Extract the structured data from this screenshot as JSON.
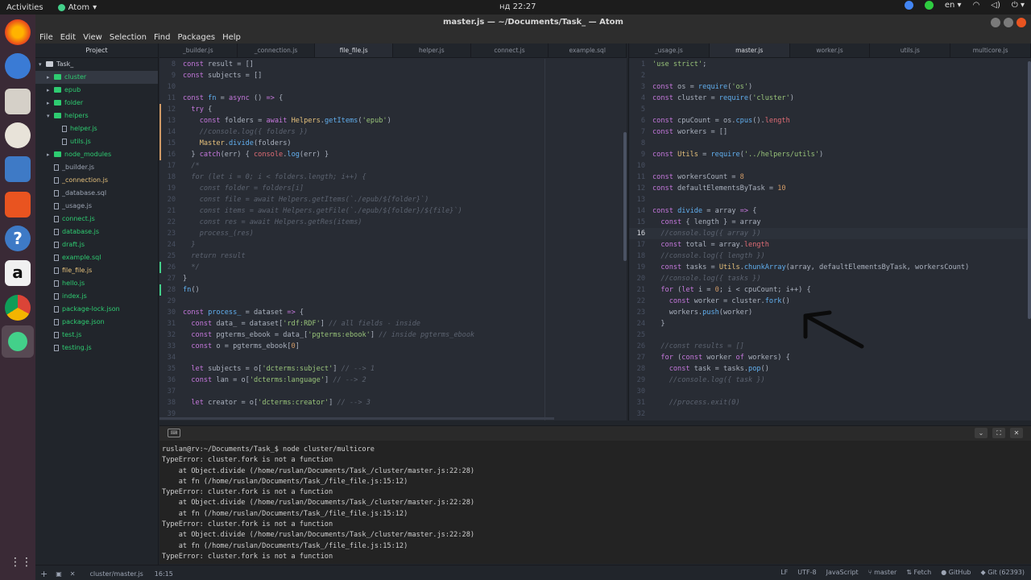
{
  "topbar": {
    "activities": "Activities",
    "app_name": "Atom",
    "clock": "нд 22:27",
    "lang": "en"
  },
  "window": {
    "title": "master.js — ~/Documents/Task_ — Atom"
  },
  "menu": [
    "File",
    "Edit",
    "View",
    "Selection",
    "Find",
    "Packages",
    "Help"
  ],
  "tree": {
    "title": "Project",
    "items": [
      {
        "label": "Task_",
        "type": "root",
        "indent": 0
      },
      {
        "label": "cluster",
        "type": "folder",
        "indent": 1,
        "selected": true
      },
      {
        "label": "epub",
        "type": "folder",
        "indent": 1
      },
      {
        "label": "folder",
        "type": "folder",
        "indent": 1
      },
      {
        "label": "helpers",
        "type": "folder-open",
        "indent": 1
      },
      {
        "label": "helper.js",
        "type": "file",
        "indent": 2
      },
      {
        "label": "utils.js",
        "type": "file",
        "indent": 2
      },
      {
        "label": "node_modules",
        "type": "folder",
        "indent": 1
      },
      {
        "label": "_builder.js",
        "type": "file",
        "indent": 1,
        "muted": true
      },
      {
        "label": "_connection.js",
        "type": "file",
        "indent": 1,
        "yellow": true
      },
      {
        "label": "_database.sql",
        "type": "file",
        "indent": 1,
        "muted": true
      },
      {
        "label": "_usage.js",
        "type": "file",
        "indent": 1,
        "muted": true
      },
      {
        "label": "connect.js",
        "type": "file",
        "indent": 1
      },
      {
        "label": "database.js",
        "type": "file",
        "indent": 1
      },
      {
        "label": "draft.js",
        "type": "file",
        "indent": 1
      },
      {
        "label": "example.sql",
        "type": "file",
        "indent": 1
      },
      {
        "label": "file_file.js",
        "type": "file",
        "indent": 1,
        "yellow": true
      },
      {
        "label": "hello.js",
        "type": "file",
        "indent": 1
      },
      {
        "label": "index.js",
        "type": "file",
        "indent": 1
      },
      {
        "label": "package-lock.json",
        "type": "file",
        "indent": 1
      },
      {
        "label": "package.json",
        "type": "file",
        "indent": 1
      },
      {
        "label": "test.js",
        "type": "file",
        "indent": 1
      },
      {
        "label": "testing.js",
        "type": "file",
        "indent": 1
      }
    ]
  },
  "left_tabs": [
    "_builder.js",
    "_connection.js",
    "file_file.js",
    "helper.js",
    "connect.js",
    "example.sql"
  ],
  "left_active_tab": 2,
  "right_tabs": [
    "_usage.js",
    "master.js",
    "worker.js",
    "utils.js",
    "multicore.js"
  ],
  "right_active_tab": 1,
  "left_code": [
    {
      "n": "8",
      "h": "<span class='k'>const</span> result = []"
    },
    {
      "n": "9",
      "h": "<span class='k'>const</span> subjects = []"
    },
    {
      "n": "10",
      "h": ""
    },
    {
      "n": "11",
      "h": "<span class='k'>const</span> <span class='f'>fn</span> = <span class='k'>async</span> () <span class='k'>=&gt;</span> {"
    },
    {
      "n": "12",
      "h": "  <span class='k'>try</span> {",
      "mod": true
    },
    {
      "n": "13",
      "h": "    <span class='k'>const</span> folders = <span class='k'>await</span> <span class='cls'>Helpers</span>.<span class='f'>getItems</span>(<span class='s'>'epub'</span>)",
      "mod": true
    },
    {
      "n": "14",
      "h": "    <span class='c'>//console.log({ folders })</span>",
      "mod": true
    },
    {
      "n": "15",
      "h": "    <span class='cls'>Master</span>.<span class='f'>divide</span>(folders)",
      "mod": true
    },
    {
      "n": "16",
      "h": "  } <span class='k'>catch</span>(err) { <span class='r'>console</span>.<span class='f'>log</span>(err) }",
      "mod": true
    },
    {
      "n": "17",
      "h": "  <span class='c'>/*</span>"
    },
    {
      "n": "18",
      "h": "  <span class='c'>for (let i = 0; i &lt; folders.length; i++) {</span>"
    },
    {
      "n": "19",
      "h": "    <span class='c'>const folder = folders[i]</span>"
    },
    {
      "n": "20",
      "h": "    <span class='c'>const file = await Helpers.getItems(`./epub/${folder}`)</span>"
    },
    {
      "n": "21",
      "h": "    <span class='c'>const items = await Helpers.getFile(`./epub/${folder}/${file}`)</span>"
    },
    {
      "n": "22",
      "h": "    <span class='c'>const res = await Helpers.getRes(items)</span>"
    },
    {
      "n": "23",
      "h": "    <span class='c'>process_(res)</span>"
    },
    {
      "n": "24",
      "h": "  <span class='c'>}</span>"
    },
    {
      "n": "25",
      "h": "  <span class='c'>return result</span>"
    },
    {
      "n": "26",
      "h": "  <span class='c'>*/</span>",
      "add": true
    },
    {
      "n": "27",
      "h": "}"
    },
    {
      "n": "28",
      "h": "<span class='f'>fn</span>()",
      "add": true
    },
    {
      "n": "29",
      "h": ""
    },
    {
      "n": "30",
      "h": "<span class='k'>const</span> <span class='f'>process_</span> = dataset <span class='k'>=&gt;</span> {"
    },
    {
      "n": "31",
      "h": "  <span class='k'>const</span> data_ = dataset[<span class='s'>'rdf:RDF'</span>] <span class='c'>// all fields - inside</span>"
    },
    {
      "n": "32",
      "h": "  <span class='k'>const</span> pgterms_ebook = data_[<span class='s'>'pgterms:ebook'</span>] <span class='c'>// inside pgterms_ebook</span>"
    },
    {
      "n": "33",
      "h": "  <span class='k'>const</span> o = pgterms_ebook[<span class='n'>0</span>]"
    },
    {
      "n": "34",
      "h": ""
    },
    {
      "n": "35",
      "h": "  <span class='k'>let</span> subjects = o[<span class='s'>'dcterms:subject'</span>] <span class='c'>// --&gt; 1</span>"
    },
    {
      "n": "36",
      "h": "  <span class='k'>const</span> lan = o[<span class='s'>'dcterms:language'</span>] <span class='c'>// --&gt; 2</span>"
    },
    {
      "n": "37",
      "h": ""
    },
    {
      "n": "38",
      "h": "  <span class='k'>let</span> creator = o[<span class='s'>'dcterms:creator'</span>] <span class='c'>// --&gt; 3</span>"
    },
    {
      "n": "39",
      "h": ""
    }
  ],
  "right_code": [
    {
      "n": "1",
      "h": "<span class='s'>'use strict'</span>;"
    },
    {
      "n": "2",
      "h": ""
    },
    {
      "n": "3",
      "h": "<span class='k'>const</span> os = <span class='f'>require</span>(<span class='s'>'os'</span>)"
    },
    {
      "n": "4",
      "h": "<span class='k'>const</span> cluster = <span class='f'>require</span>(<span class='s'>'cluster'</span>)"
    },
    {
      "n": "5",
      "h": ""
    },
    {
      "n": "6",
      "h": "<span class='k'>const</span> cpuCount = os.<span class='f'>cpus</span>().<span class='r'>length</span>"
    },
    {
      "n": "7",
      "h": "<span class='k'>const</span> workers = []"
    },
    {
      "n": "8",
      "h": ""
    },
    {
      "n": "9",
      "h": "<span class='k'>const</span> <span class='cls'>Utils</span> = <span class='f'>require</span>(<span class='s'>'../helpers/utils'</span>)"
    },
    {
      "n": "10",
      "h": ""
    },
    {
      "n": "11",
      "h": "<span class='k'>const</span> workersCount = <span class='n'>8</span>"
    },
    {
      "n": "12",
      "h": "<span class='k'>const</span> defaultElementsByTask = <span class='n'>10</span>"
    },
    {
      "n": "13",
      "h": ""
    },
    {
      "n": "14",
      "h": "<span class='k'>const</span> <span class='f'>divide</span> = array <span class='k'>=&gt;</span> {"
    },
    {
      "n": "15",
      "h": "  <span class='k'>const</span> { length } = array"
    },
    {
      "n": "16",
      "h": "  <span class='c'>//console.log({ array })</span>",
      "cur": true
    },
    {
      "n": "17",
      "h": "  <span class='k'>const</span> total = array.<span class='r'>length</span>"
    },
    {
      "n": "18",
      "h": "  <span class='c'>//console.log({ length })</span>"
    },
    {
      "n": "19",
      "h": "  <span class='k'>const</span> tasks = <span class='cls'>Utils</span>.<span class='f'>chunkArray</span>(array, defaultElementsByTask, workersCount)"
    },
    {
      "n": "20",
      "h": "  <span class='c'>//console.log({ tasks })</span>"
    },
    {
      "n": "21",
      "h": "  <span class='k'>for</span> (<span class='k'>let</span> i = <span class='n'>0</span>; i &lt; cpuCount; i++) {"
    },
    {
      "n": "22",
      "h": "    <span class='k'>const</span> worker = cluster.<span class='f'>fork</span>()"
    },
    {
      "n": "23",
      "h": "    workers.<span class='f'>push</span>(worker)"
    },
    {
      "n": "24",
      "h": "  }"
    },
    {
      "n": "25",
      "h": ""
    },
    {
      "n": "26",
      "h": "  <span class='c'>//const results = []</span>"
    },
    {
      "n": "27",
      "h": "  <span class='k'>for</span> (<span class='k'>const</span> worker <span class='k'>of</span> workers) {"
    },
    {
      "n": "28",
      "h": "    <span class='k'>const</span> task = tasks.<span class='f'>pop</span>()"
    },
    {
      "n": "29",
      "h": "    <span class='c'>//console.log({ task })</span>"
    },
    {
      "n": "30",
      "h": ""
    },
    {
      "n": "31",
      "h": "    <span class='c'>//process.exit(0)</span>"
    },
    {
      "n": "32",
      "h": ""
    }
  ],
  "terminal": {
    "lines": [
      "ruslan@rv:~/Documents/Task_$ node cluster/multicore",
      "TypeError: cluster.fork is not a function",
      "    at Object.divide (/home/ruslan/Documents/Task_/cluster/master.js:22:28)",
      "    at fn (/home/ruslan/Documents/Task_/file_file.js:15:12)",
      "TypeError: cluster.fork is not a function",
      "    at Object.divide (/home/ruslan/Documents/Task_/cluster/master.js:22:28)",
      "    at fn (/home/ruslan/Documents/Task_/file_file.js:15:12)",
      "TypeError: cluster.fork is not a function",
      "    at Object.divide (/home/ruslan/Documents/Task_/cluster/master.js:22:28)",
      "    at fn (/home/ruslan/Documents/Task_/file_file.js:15:12)",
      "TypeError: cluster.fork is not a function"
    ]
  },
  "status": {
    "file": "cluster/master.js",
    "cursor": "16:15",
    "line_ending": "LF",
    "encoding": "UTF-8",
    "grammar": "JavaScript",
    "branch": "master",
    "fetch": "Fetch",
    "github": "GitHub",
    "git": "Git (62393)"
  },
  "colors": {
    "accent_orange": "#e95420",
    "tree_green": "#2ecc71",
    "editor_bg": "#282c34"
  }
}
